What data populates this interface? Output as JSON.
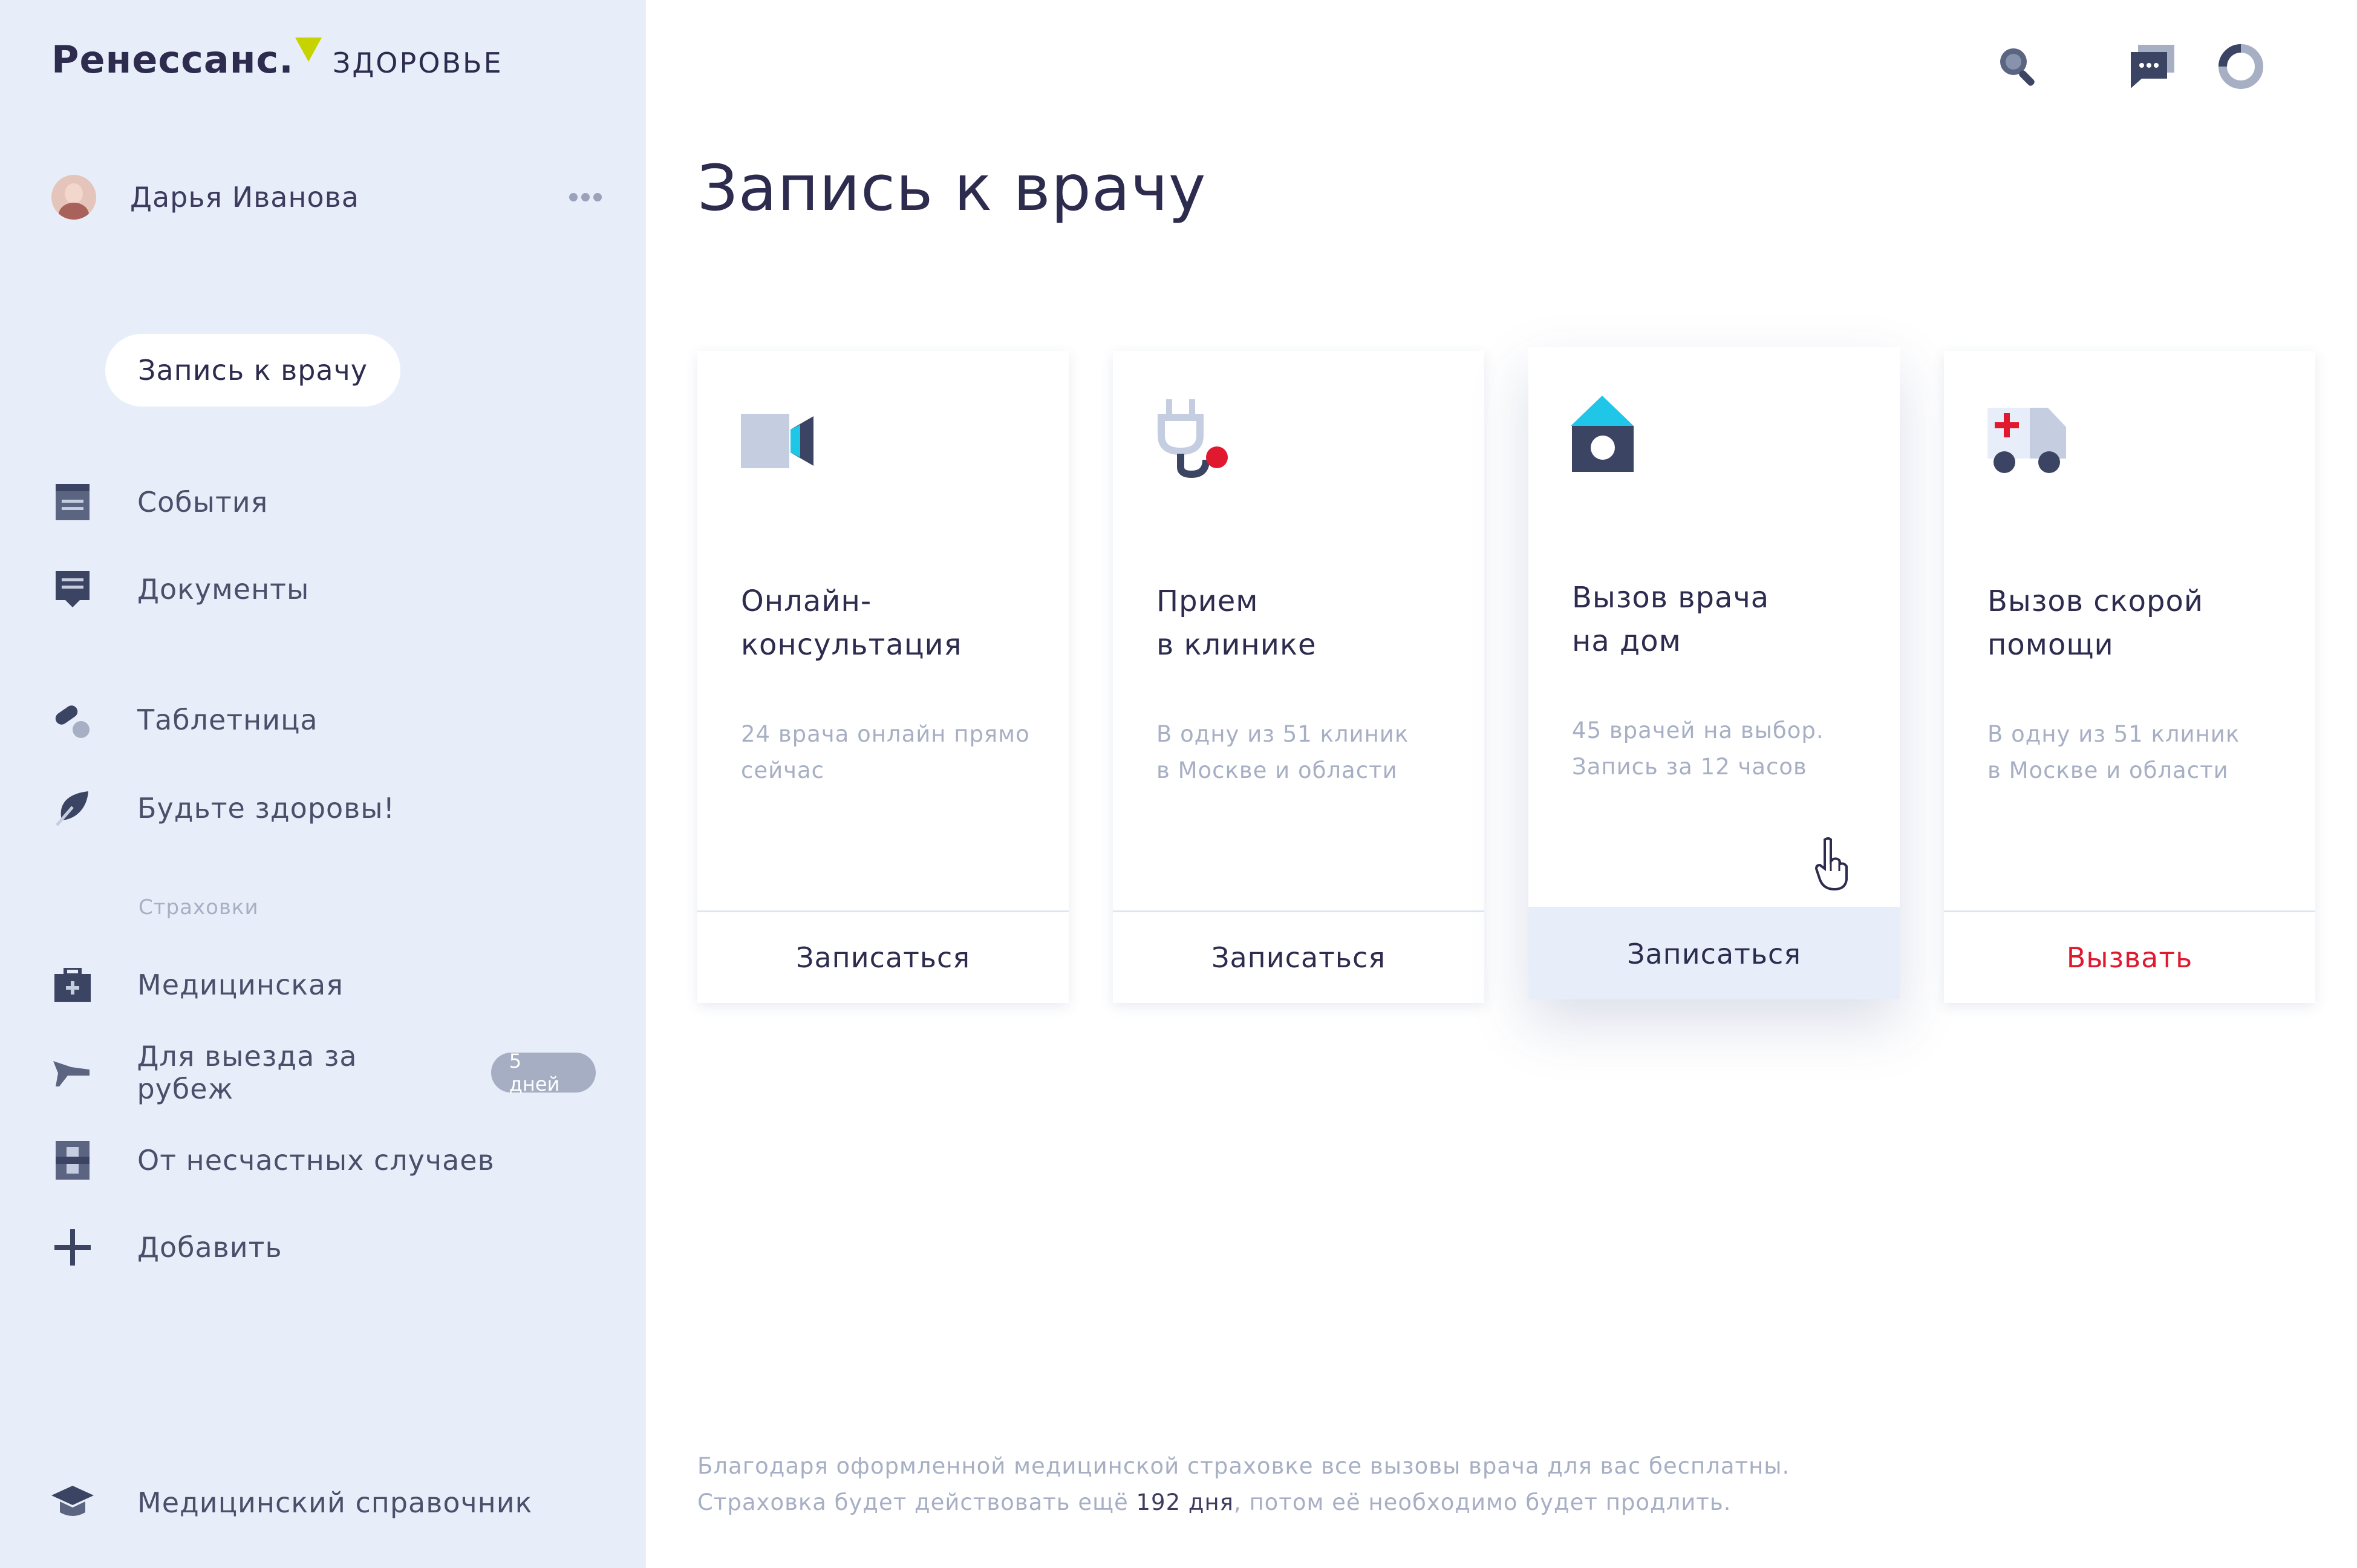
{
  "brand": {
    "name": "Ренессанс.",
    "sub": "ЗДОРОВЬЕ",
    "accent": "#c7d300"
  },
  "user": {
    "name": "Дарья Иванова"
  },
  "sidebar": {
    "active": "Запись к врачу",
    "items": [
      {
        "label": "События",
        "icon": "calendar-icon"
      },
      {
        "label": "Документы",
        "icon": "document-icon"
      },
      {
        "label": "Таблетница",
        "icon": "pill-icon"
      },
      {
        "label": "Будьте здоровы!",
        "icon": "leaf-icon"
      }
    ],
    "section": "Страховки",
    "insurance": [
      {
        "label": "Медицинская",
        "icon": "medkit-icon"
      },
      {
        "label": "Для выезда за рубеж",
        "icon": "plane-icon",
        "badge": "5 дней"
      },
      {
        "label": "От несчастных случаев",
        "icon": "bandage-icon"
      },
      {
        "label": "Добавить",
        "icon": "plus-icon"
      }
    ],
    "bottom": {
      "label": "Медицинский справочник",
      "icon": "graduation-cap-icon"
    }
  },
  "header": {
    "icons": [
      "search-icon",
      "chat-icon",
      "profile-ring-icon"
    ]
  },
  "main": {
    "title": "Запись к врачу",
    "cards": [
      {
        "title": "Онлайн-\nконсультация",
        "desc": "24 врача онлайн прямо\nсейчас",
        "button": "Записаться",
        "icon": "video-camera-icon"
      },
      {
        "title": "Прием\nв клинике",
        "desc": "В одну из 51 клиник\nв Москве и области",
        "button": "Записаться",
        "icon": "stethoscope-icon"
      },
      {
        "title": "Вызов врача\nна дом",
        "desc": "45 врачей на выбор.\nЗапись за 12 часов",
        "button": "Записаться",
        "icon": "house-icon",
        "active": true
      },
      {
        "title": "Вызов скорой\nпомощи",
        "desc": "В одну из 51 клиник\nв Москве и области",
        "button": "Вызвать",
        "icon": "ambulance-icon",
        "button_color": "#e0192f"
      }
    ],
    "footer": {
      "line1": "Благодаря оформленной медицинской страховке все вызовы врача для вас бесплатны.",
      "line2_pre": "Страховка будет действовать ещё ",
      "line2_days": "192 дня",
      "line2_post": ", потом её необходимо будет продлить."
    }
  },
  "colors": {
    "sidebar_bg": "#e8eef9",
    "text": "#2d2b4e",
    "muted": "#a7afc4",
    "cyan": "#1fc6e8",
    "red": "#e0192f",
    "navy": "#3c4463"
  }
}
